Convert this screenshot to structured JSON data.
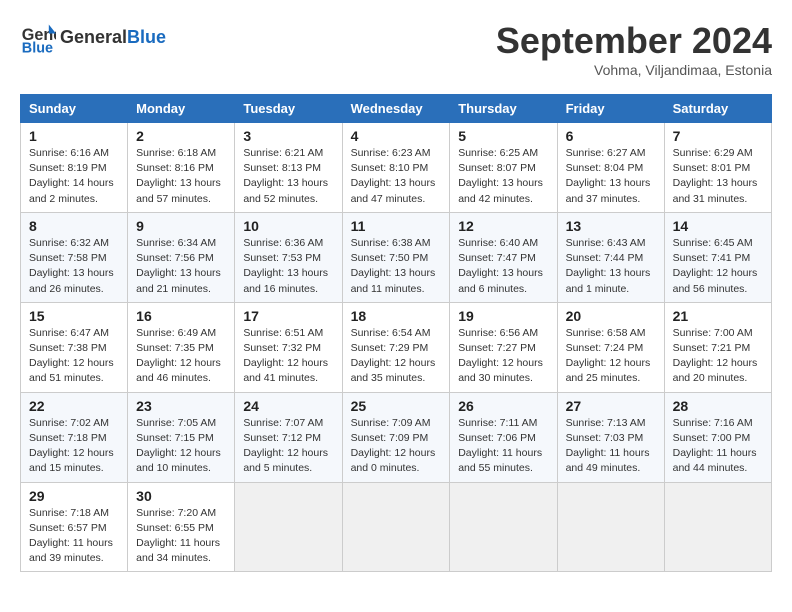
{
  "header": {
    "logo_line1": "General",
    "logo_line2": "Blue",
    "month": "September 2024",
    "location": "Vohma, Viljandimaa, Estonia"
  },
  "weekdays": [
    "Sunday",
    "Monday",
    "Tuesday",
    "Wednesday",
    "Thursday",
    "Friday",
    "Saturday"
  ],
  "weeks": [
    [
      {
        "day": "1",
        "info": "Sunrise: 6:16 AM\nSunset: 8:19 PM\nDaylight: 14 hours\nand 2 minutes."
      },
      {
        "day": "2",
        "info": "Sunrise: 6:18 AM\nSunset: 8:16 PM\nDaylight: 13 hours\nand 57 minutes."
      },
      {
        "day": "3",
        "info": "Sunrise: 6:21 AM\nSunset: 8:13 PM\nDaylight: 13 hours\nand 52 minutes."
      },
      {
        "day": "4",
        "info": "Sunrise: 6:23 AM\nSunset: 8:10 PM\nDaylight: 13 hours\nand 47 minutes."
      },
      {
        "day": "5",
        "info": "Sunrise: 6:25 AM\nSunset: 8:07 PM\nDaylight: 13 hours\nand 42 minutes."
      },
      {
        "day": "6",
        "info": "Sunrise: 6:27 AM\nSunset: 8:04 PM\nDaylight: 13 hours\nand 37 minutes."
      },
      {
        "day": "7",
        "info": "Sunrise: 6:29 AM\nSunset: 8:01 PM\nDaylight: 13 hours\nand 31 minutes."
      }
    ],
    [
      {
        "day": "8",
        "info": "Sunrise: 6:32 AM\nSunset: 7:58 PM\nDaylight: 13 hours\nand 26 minutes."
      },
      {
        "day": "9",
        "info": "Sunrise: 6:34 AM\nSunset: 7:56 PM\nDaylight: 13 hours\nand 21 minutes."
      },
      {
        "day": "10",
        "info": "Sunrise: 6:36 AM\nSunset: 7:53 PM\nDaylight: 13 hours\nand 16 minutes."
      },
      {
        "day": "11",
        "info": "Sunrise: 6:38 AM\nSunset: 7:50 PM\nDaylight: 13 hours\nand 11 minutes."
      },
      {
        "day": "12",
        "info": "Sunrise: 6:40 AM\nSunset: 7:47 PM\nDaylight: 13 hours\nand 6 minutes."
      },
      {
        "day": "13",
        "info": "Sunrise: 6:43 AM\nSunset: 7:44 PM\nDaylight: 13 hours\nand 1 minute."
      },
      {
        "day": "14",
        "info": "Sunrise: 6:45 AM\nSunset: 7:41 PM\nDaylight: 12 hours\nand 56 minutes."
      }
    ],
    [
      {
        "day": "15",
        "info": "Sunrise: 6:47 AM\nSunset: 7:38 PM\nDaylight: 12 hours\nand 51 minutes."
      },
      {
        "day": "16",
        "info": "Sunrise: 6:49 AM\nSunset: 7:35 PM\nDaylight: 12 hours\nand 46 minutes."
      },
      {
        "day": "17",
        "info": "Sunrise: 6:51 AM\nSunset: 7:32 PM\nDaylight: 12 hours\nand 41 minutes."
      },
      {
        "day": "18",
        "info": "Sunrise: 6:54 AM\nSunset: 7:29 PM\nDaylight: 12 hours\nand 35 minutes."
      },
      {
        "day": "19",
        "info": "Sunrise: 6:56 AM\nSunset: 7:27 PM\nDaylight: 12 hours\nand 30 minutes."
      },
      {
        "day": "20",
        "info": "Sunrise: 6:58 AM\nSunset: 7:24 PM\nDaylight: 12 hours\nand 25 minutes."
      },
      {
        "day": "21",
        "info": "Sunrise: 7:00 AM\nSunset: 7:21 PM\nDaylight: 12 hours\nand 20 minutes."
      }
    ],
    [
      {
        "day": "22",
        "info": "Sunrise: 7:02 AM\nSunset: 7:18 PM\nDaylight: 12 hours\nand 15 minutes."
      },
      {
        "day": "23",
        "info": "Sunrise: 7:05 AM\nSunset: 7:15 PM\nDaylight: 12 hours\nand 10 minutes."
      },
      {
        "day": "24",
        "info": "Sunrise: 7:07 AM\nSunset: 7:12 PM\nDaylight: 12 hours\nand 5 minutes."
      },
      {
        "day": "25",
        "info": "Sunrise: 7:09 AM\nSunset: 7:09 PM\nDaylight: 12 hours\nand 0 minutes."
      },
      {
        "day": "26",
        "info": "Sunrise: 7:11 AM\nSunset: 7:06 PM\nDaylight: 11 hours\nand 55 minutes."
      },
      {
        "day": "27",
        "info": "Sunrise: 7:13 AM\nSunset: 7:03 PM\nDaylight: 11 hours\nand 49 minutes."
      },
      {
        "day": "28",
        "info": "Sunrise: 7:16 AM\nSunset: 7:00 PM\nDaylight: 11 hours\nand 44 minutes."
      }
    ],
    [
      {
        "day": "29",
        "info": "Sunrise: 7:18 AM\nSunset: 6:57 PM\nDaylight: 11 hours\nand 39 minutes."
      },
      {
        "day": "30",
        "info": "Sunrise: 7:20 AM\nSunset: 6:55 PM\nDaylight: 11 hours\nand 34 minutes."
      },
      {
        "day": "",
        "info": ""
      },
      {
        "day": "",
        "info": ""
      },
      {
        "day": "",
        "info": ""
      },
      {
        "day": "",
        "info": ""
      },
      {
        "day": "",
        "info": ""
      }
    ]
  ]
}
